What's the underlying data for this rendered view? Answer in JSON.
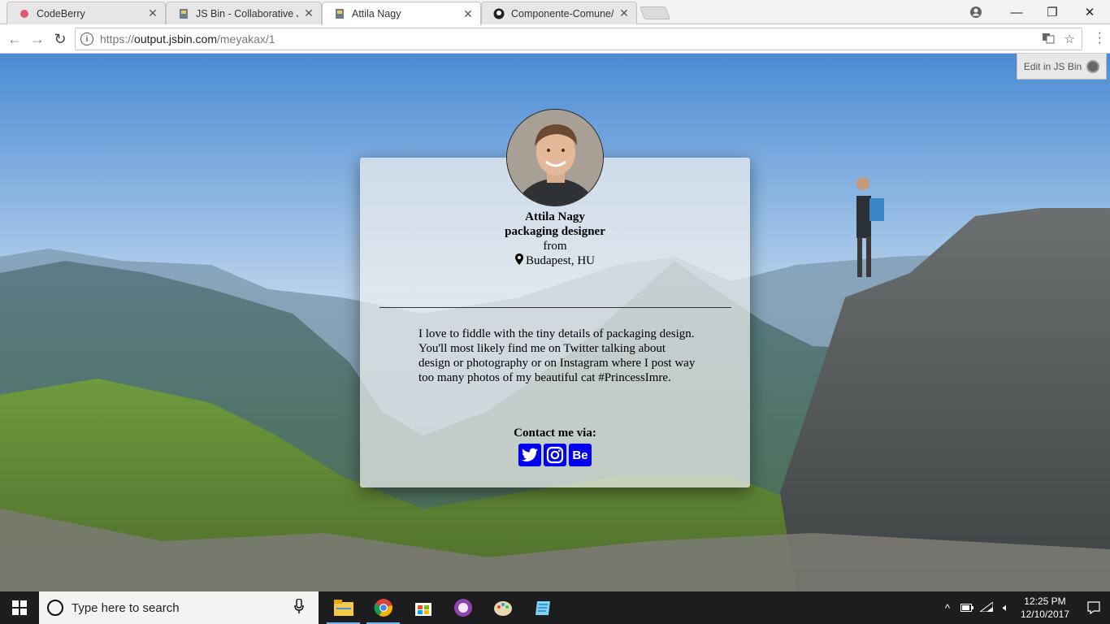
{
  "browser": {
    "tabs": [
      {
        "label": "CodeBerry",
        "icon": "codeberry-icon",
        "active": false
      },
      {
        "label": "JS Bin - Collaborative Jav",
        "icon": "jsbin-icon",
        "active": false
      },
      {
        "label": "Attila Nagy",
        "icon": "jsbin-icon",
        "active": true
      },
      {
        "label": "Componente-Comune/N",
        "icon": "github-icon",
        "active": false
      }
    ],
    "url": {
      "scheme": "https://",
      "host": "output.jsbin.com",
      "path": "/meyakax/1"
    }
  },
  "page": {
    "edit_in_jsbin": "Edit in JS Bin",
    "profile": {
      "name": "Attila Nagy",
      "role": "packaging designer",
      "from_label": "from",
      "location": "Budapest, HU",
      "bio": "I love to fiddle with the tiny details of packaging design. You'll most likely find me on Twitter talking about design or photography or on Instagram where I post way too many photos of my beautiful cat #PrincessImre.",
      "contact_label": "Contact me via:",
      "socials": [
        {
          "name": "twitter",
          "glyph": ""
        },
        {
          "name": "instagram",
          "glyph": ""
        },
        {
          "name": "behance",
          "glyph": "Be"
        }
      ]
    }
  },
  "taskbar": {
    "search_placeholder": "Type here to search",
    "time": "12:25 PM",
    "date": "12/10/2017"
  },
  "colors": {
    "link_blue": "#0000ee",
    "taskbar": "#1d1d1f"
  }
}
